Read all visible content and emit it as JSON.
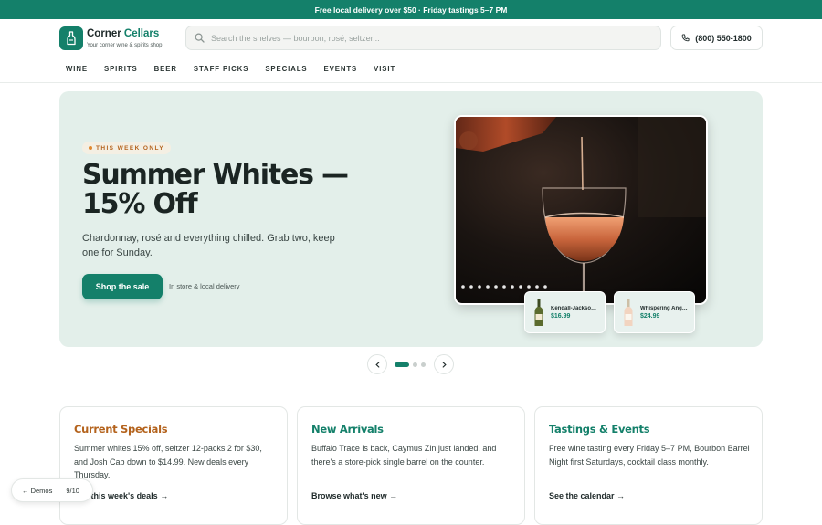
{
  "promo_bar": {
    "text": "Free local delivery over $50 · Friday tastings 5–7 PM"
  },
  "brand": {
    "name_part1": "Corner",
    "name_part2": "Cellars",
    "tagline": "Your corner wine & spirits shop",
    "logo_icon": "bottle-icon"
  },
  "search": {
    "placeholder": "Search the shelves — bourbon, rosé, seltzer...",
    "value": "",
    "icon": "search-icon"
  },
  "phone": {
    "label": "(800) 550-1800",
    "icon": "phone-icon"
  },
  "nav": {
    "items": [
      "WINE",
      "SPIRITS",
      "BEER",
      "STAFF PICKS",
      "SPECIALS",
      "EVENTS",
      "VISIT"
    ]
  },
  "hero": {
    "badge": "THIS WEEK ONLY",
    "title": "Summer Whites — 15% Off",
    "subtitle": "Chardonnay, rosé and everything chilled. Grab two, keep one for Sunday.",
    "cta": "Shop the sale",
    "note": "In store & local delivery",
    "products": [
      {
        "name": "Kendall-Jackson Vintner's Reserve",
        "price": "$16.99"
      },
      {
        "name": "Whispering Angel Rosé",
        "price": "$24.99"
      }
    ]
  },
  "carousel": {
    "slides": 3,
    "active": 1,
    "prev_icon": "chevron-left-icon",
    "next_icon": "chevron-right-icon"
  },
  "cards": [
    {
      "title": "Current Specials",
      "color": "#b4631d",
      "body": "Summer whites 15% off, seltzer 12-packs 2 for $30, and Josh Cab down to $14.99. New deals every Thursday.",
      "cta": "See this week's deals →"
    },
    {
      "title": "New Arrivals",
      "color": "#14806a",
      "body": "Buffalo Trace is back, Caymus Zin just landed, and there's a store-pick single barrel on the counter.",
      "cta": "Browse what's new →"
    },
    {
      "title": "Tastings & Events",
      "color": "#14806a",
      "body": "Free wine tasting every Friday 5–7 PM, Bourbon Barrel Night first Saturdays, cocktail class monthly.",
      "cta": "See the calendar →"
    }
  ],
  "demos_pill": {
    "label": "← Demos",
    "counter": "9/10"
  },
  "colors": {
    "accent": "#14806a",
    "orange": "#b4631d",
    "hero_bg": "#e3efea"
  }
}
